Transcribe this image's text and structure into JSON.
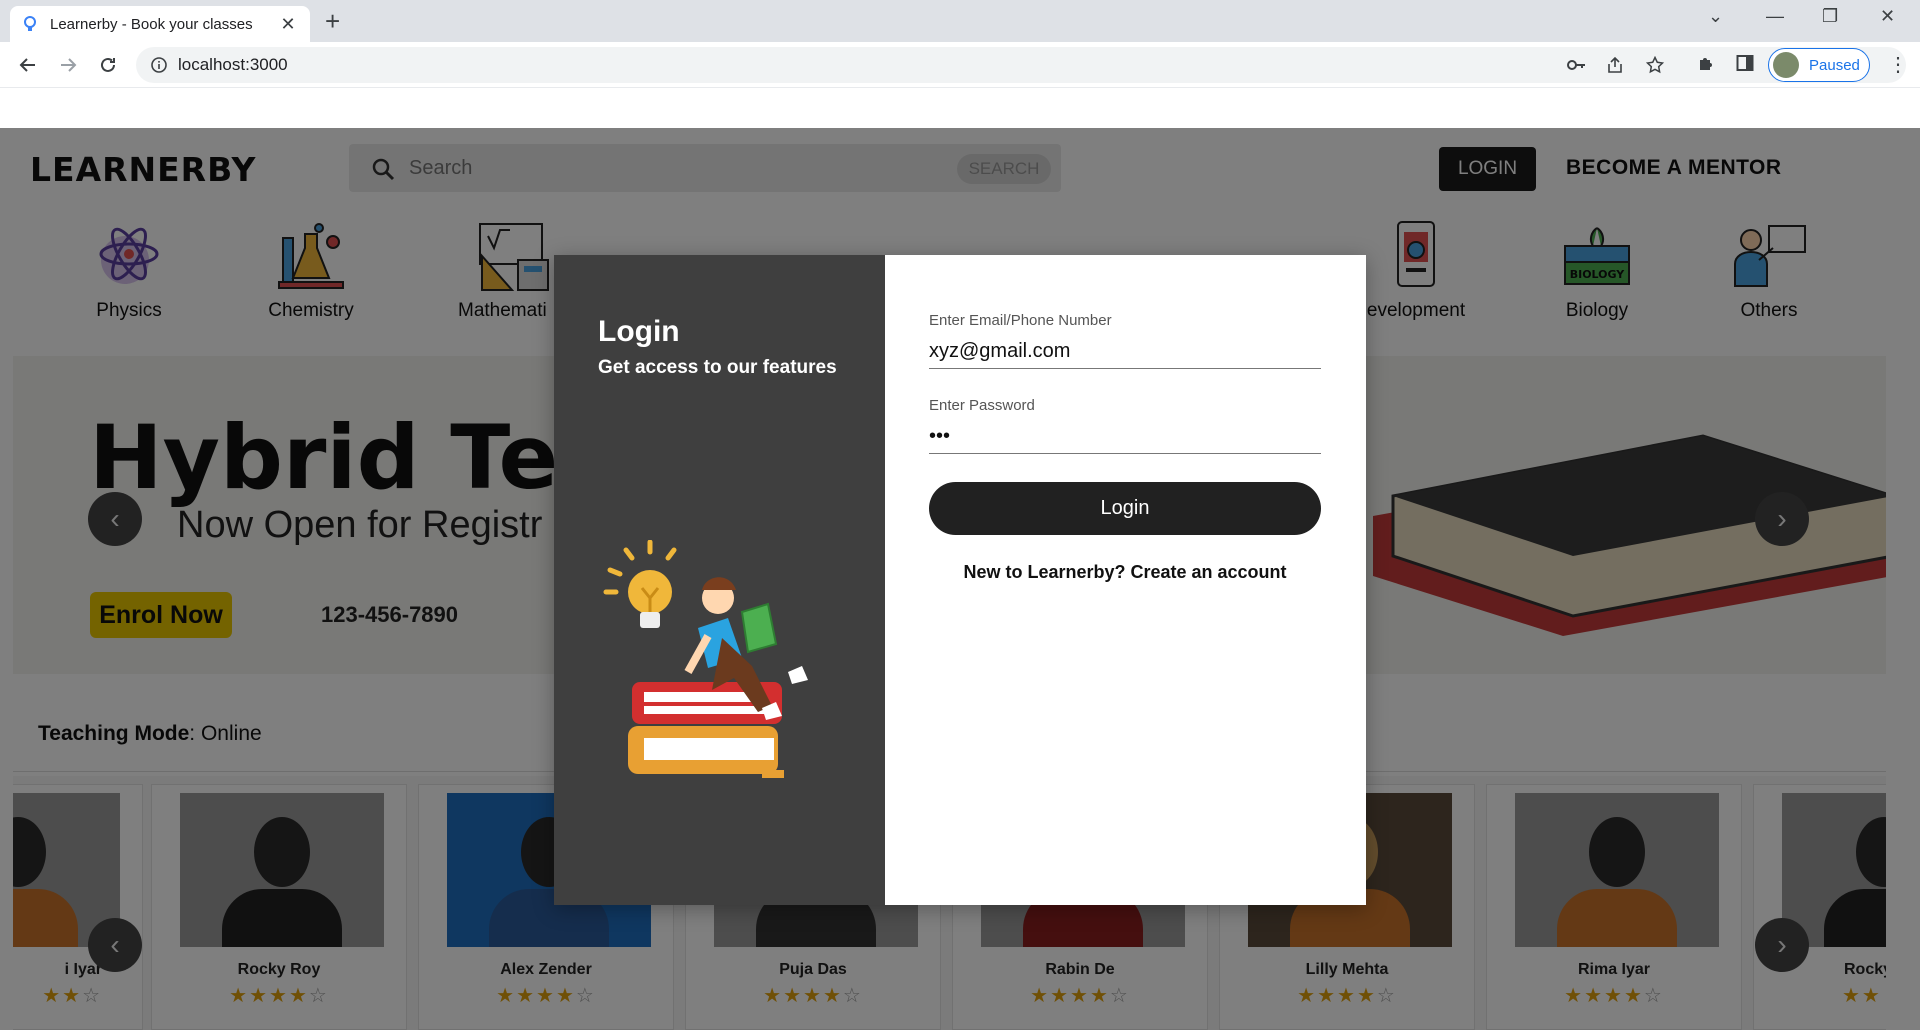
{
  "browser": {
    "tab_title": "Learnerby - Book your classes",
    "url": "localhost:3000",
    "profile_status": "Paused"
  },
  "header": {
    "logo": "LEARNERBY",
    "search_placeholder": "Search",
    "search_button": "SEARCH",
    "login_button": "LOGIN",
    "mentor_link": "BECOME A MENTOR"
  },
  "categories": [
    {
      "label": "Physics",
      "icon": "atom-icon"
    },
    {
      "label": "Chemistry",
      "icon": "lab-flasks-icon"
    },
    {
      "label": "Mathemati",
      "icon": "math-tools-icon"
    },
    {
      "label": "evelopment",
      "icon": "development-icon"
    },
    {
      "label": "Biology",
      "icon": "biology-book-icon"
    },
    {
      "label": "Others",
      "icon": "teacher-board-icon"
    }
  ],
  "banner": {
    "headline": "Hybrid Tea",
    "subline": "Now Open for Registr",
    "enrol_button": "Enrol Now",
    "phone": "123-456-7890"
  },
  "teaching_mode": {
    "label": "Teaching Mode",
    "value": "Online"
  },
  "mentors": [
    {
      "name": "i Iyar",
      "rating": 4
    },
    {
      "name": "Rocky Roy",
      "rating": 4
    },
    {
      "name": "Alex Zender",
      "rating": 4
    },
    {
      "name": "Puja Das",
      "rating": 4
    },
    {
      "name": "Rabin De",
      "rating": 4
    },
    {
      "name": "Lilly Mehta",
      "rating": 4
    },
    {
      "name": "Rima Iyar",
      "rating": 4
    },
    {
      "name": "Rocky",
      "rating": 4
    }
  ],
  "modal": {
    "title": "Login",
    "subtitle": "Get access to our features",
    "email_label": "Enter Email/Phone Number",
    "email_value": "xyz@gmail.com",
    "password_label": "Enter Password",
    "password_value": "•••",
    "login_button": "Login",
    "create_account": "New to Learnerby? Create an account"
  }
}
